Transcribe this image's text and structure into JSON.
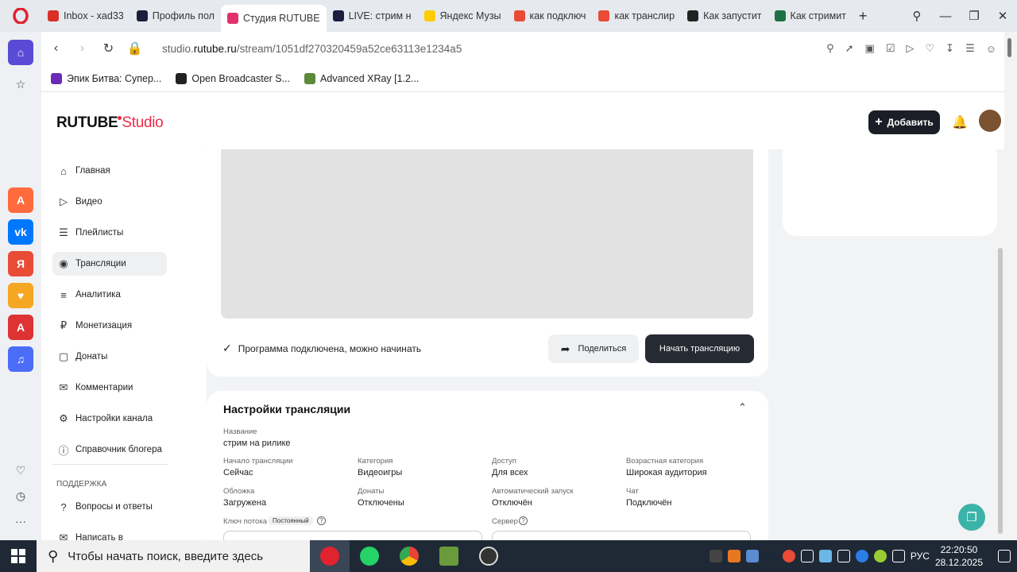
{
  "browser": {
    "tabs": [
      {
        "label": "Inbox - xad33",
        "favicon": "gmail-icon",
        "color": "#d93025"
      },
      {
        "label": "Профиль пол",
        "favicon": "rutube-icon",
        "color": "#1b1e3c"
      },
      {
        "label": "Студия RUTUBE",
        "favicon": "rutube-studio-icon",
        "color": "#e1306c",
        "active": true
      },
      {
        "label": "LIVE: стрим н",
        "favicon": "rutube-icon",
        "color": "#1b1e3c"
      },
      {
        "label": "Яндекс Музы",
        "favicon": "yandex-music-icon",
        "color": "#ffcc00"
      },
      {
        "label": "как подключ",
        "favicon": "yandex-icon",
        "color": "#e94b35"
      },
      {
        "label": "как транслир",
        "favicon": "yandex-icon",
        "color": "#e94b35"
      },
      {
        "label": "Как запустит",
        "favicon": "bro-icon",
        "color": "#222222"
      },
      {
        "label": "Как стримит",
        "favicon": "excel-icon",
        "color": "#1e7145"
      }
    ],
    "url_prefix": "studio.",
    "url_domain": "rutube.ru",
    "url_path": "/stream/1051df270320459a52ce63113e1234a5",
    "bookmarks": [
      {
        "label": "Эпик Битва: Супер...",
        "color": "#6a2bb8"
      },
      {
        "label": "Open Broadcaster S...",
        "color": "#222222"
      },
      {
        "label": "Advanced XRay [1.2...",
        "color": "#5a8a3a"
      }
    ]
  },
  "studio": {
    "logo_main": "RUTUBE",
    "logo_sub": "Studio",
    "add_button": "Добавить",
    "nav": [
      {
        "label": "Главная",
        "icon": "home-icon"
      },
      {
        "label": "Видео",
        "icon": "video-icon"
      },
      {
        "label": "Плейлисты",
        "icon": "playlist-icon"
      },
      {
        "label": "Трансляции",
        "icon": "broadcast-icon",
        "selected": true
      },
      {
        "label": "Аналитика",
        "icon": "analytics-icon"
      },
      {
        "label": "Монетизация",
        "icon": "ruble-icon"
      },
      {
        "label": "Донаты",
        "icon": "donate-icon"
      },
      {
        "label": "Комментарии",
        "icon": "comment-icon"
      },
      {
        "label": "Настройки канала",
        "icon": "settings-icon"
      },
      {
        "label": "Справочник блогера",
        "icon": "info-icon"
      }
    ],
    "support_title": "ПОДДЕРЖКА",
    "support_items": [
      {
        "label": "Вопросы и ответы",
        "icon": "question-icon"
      },
      {
        "label": "Написать в",
        "icon": "chat-icon"
      }
    ],
    "stream": {
      "status_text": "Программа подключена, можно начинать",
      "share_button": "Поделиться",
      "start_button": "Начать трансляцию"
    },
    "settings": {
      "title": "Настройки трансляции",
      "name_label": "Название",
      "name_value": "стрим на рилике",
      "start_label": "Начало трансляции",
      "start_value": "Сейчас",
      "category_label": "Категория",
      "category_value": "Видеоигры",
      "access_label": "Доступ",
      "access_value": "Для всех",
      "age_label": "Возрастная категория",
      "age_value": "Широкая аудитория",
      "cover_label": "Обложка",
      "cover_value": "Загружена",
      "donations_label": "Донаты",
      "donations_value": "Отключены",
      "autostart_label": "Автоматический запуск",
      "autostart_value": "Отключён",
      "chat_label": "Чат",
      "chat_value": "Подключён",
      "key_label": "Ключ потока",
      "key_badge": "Постоянный",
      "server_label": "Сервер"
    }
  },
  "taskbar": {
    "search_placeholder": "Чтобы начать поиск, введите здесь",
    "language": "РУС",
    "time": "22:20:50",
    "date": "28.12.2025"
  }
}
